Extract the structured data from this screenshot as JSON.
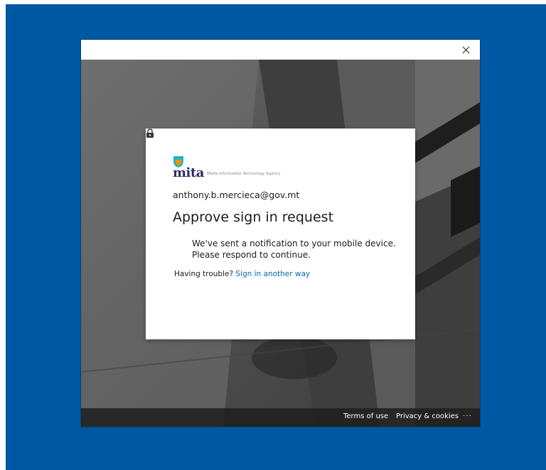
{
  "window": {
    "close_label": "×"
  },
  "logo": {
    "wordmark": "mita",
    "tagline": "Malta Information Technology Agency",
    "colors": {
      "teal": "#1fb6c1",
      "orange": "#f39200",
      "navy": "#2d2a6e"
    }
  },
  "signin": {
    "email": "anthony.b.mercieca@gov.mt",
    "title": "Approve sign in request",
    "notice_line1": "We've sent a notification to your mobile device.",
    "notice_line2": "Please respond to continue.",
    "notice_icon": "lock-icon",
    "trouble_text": "Having trouble? ",
    "alt_link": "Sign in another way"
  },
  "footer": {
    "terms": "Terms of use",
    "privacy": "Privacy & cookies",
    "more": "· · ·"
  },
  "colors": {
    "desktop": "#0058a3",
    "link": "#0067b8"
  }
}
